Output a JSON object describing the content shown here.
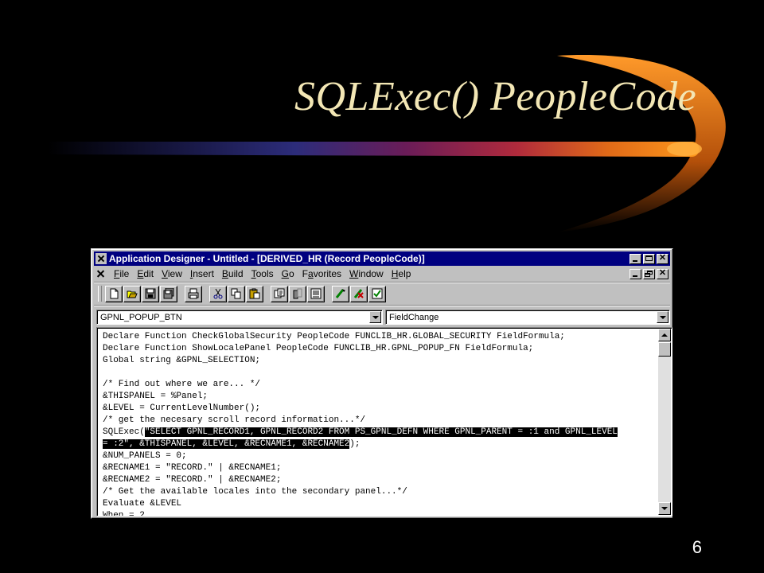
{
  "slide": {
    "title": "SQLExec() PeopleCode",
    "page_number": "6"
  },
  "window": {
    "title": "Application Designer - Untitled - [DERIVED_HR (Record PeopleCode)]",
    "menu": [
      "File",
      "Edit",
      "View",
      "Insert",
      "Build",
      "Tools",
      "Go",
      "Favorites",
      "Window",
      "Help"
    ],
    "menu_mnemonics": [
      "F",
      "E",
      "V",
      "I",
      "B",
      "T",
      "G",
      "a",
      "W",
      "H"
    ],
    "toolbar_icons": [
      "new-icon",
      "open-icon",
      "save-icon",
      "save-all-icon",
      "print-icon",
      "cut-icon",
      "copy-icon",
      "paste-icon",
      "find-icon",
      "replace-icon",
      "properties-icon",
      "validate-icon",
      "compile-icon",
      "check-icon"
    ],
    "record_field_combo": "GPNL_POPUP_BTN",
    "event_combo": "FieldChange",
    "code_lines": [
      "Declare Function CheckGlobalSecurity PeopleCode FUNCLIB_HR.GLOBAL_SECURITY FieldFormula;",
      "Declare Function ShowLocalePanel PeopleCode FUNCLIB_HR.GPNL_POPUP_FN FieldFormula;",
      "Global string &GPNL_SELECTION;",
      "",
      "/* Find out where we are... */",
      "&THISPANEL = %Panel;",
      "&LEVEL = CurrentLevelNumber();",
      "/* get the necesary scroll record information...*/",
      "SQLExec(",
      "",
      "&NUM_PANELS = 0;",
      "&RECNAME1 = \"RECORD.\" | &RECNAME1;",
      "&RECNAME2 = \"RECORD.\" | &RECNAME2;",
      "/* Get the available locales into the secondary panel...*/",
      "Evaluate &LEVEL",
      "When = 2"
    ],
    "highlighted_sql_part1": "\"SELECT GPNL_RECORD1, GPNL_RECORD2 FROM PS_GPNL_DEFN WHERE GPNL_PARENT = :1 and GPNL_LEVEL",
    "highlighted_sql_part2": "= :2\", &THISPANEL, &LEVEL, &RECNAME1, &RECNAME2",
    "sql_line_end": ");"
  },
  "colors": {
    "background": "#000000",
    "title_text": "#f3e7b5",
    "titlebar": "#000080",
    "window_face": "#c0c0c0"
  }
}
